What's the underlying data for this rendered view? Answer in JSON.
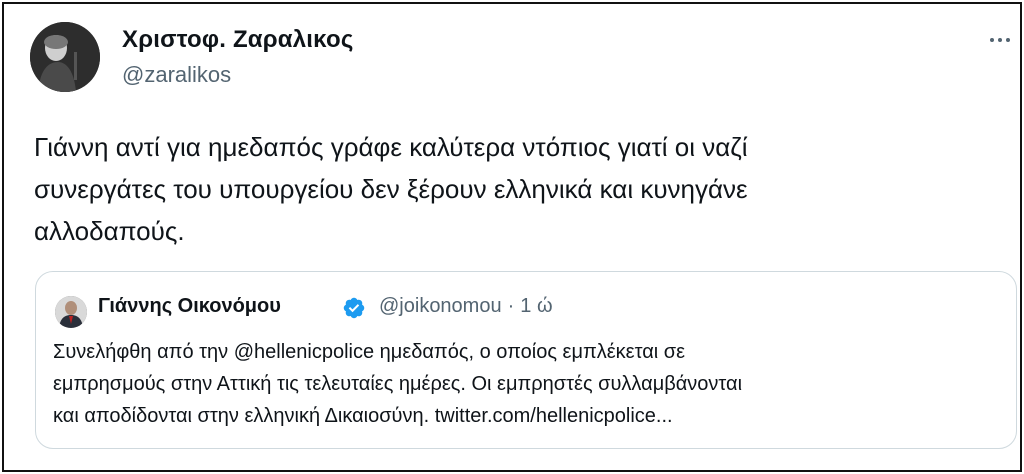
{
  "tweet": {
    "author": {
      "name": "Χριστοφ. Ζαραλικος",
      "handle": "@zaralikos"
    },
    "text_lines": [
      "Γιάννη αντί για ημεδαπός γράφε καλύτερα ντόπιος γιατί οι ναζί",
      "συνεργάτες του υπουργείου δεν ξέρουν ελληνικά και κυνηγάνε",
      "αλλοδαπούς."
    ],
    "more_icon": "more-horizontal-icon"
  },
  "quoted_tweet": {
    "author": {
      "name": "Γιάννης Οικονόμου",
      "handle": "@joikonomou",
      "separator": "·",
      "time": "1 ώ",
      "verified_icon": "verified-badge-icon"
    },
    "text_lines": [
      "Συνελήφθη από την @hellenicpolice ημεδαπός, ο οποίος εμπλέκεται σε",
      "εμπρησμούς στην Αττική τις τελευταίες ημέρες. Οι εμπρηστές συλλαμβάνονται",
      "και αποδίδονται στην ελληνική Δικαιοσύνη. twitter.com/hellenicpolice..."
    ]
  },
  "colors": {
    "text_primary": "#0f1419",
    "text_secondary": "#536471",
    "verified_blue": "#1d9bf0",
    "quote_border": "#cfd9de"
  }
}
